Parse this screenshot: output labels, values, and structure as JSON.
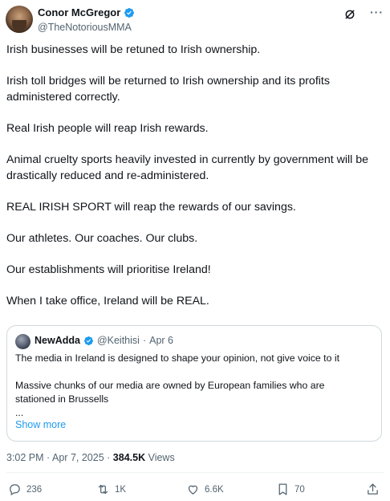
{
  "author": {
    "display_name": "Conor McGregor",
    "handle": "@TheNotoriousMMA"
  },
  "post": {
    "paragraphs": [
      "Irish businesses will be retuned to Irish ownership.",
      "Irish toll bridges will be returned to Irish ownership and its profits administered correctly.",
      "Real Irish people will reap Irish rewards.",
      "Animal cruelty sports heavily invested in currently by government will be drastically reduced and re-administered.",
      "REAL IRISH SPORT will reap the rewards of our savings.",
      "Our athletes. Our coaches. Our clubs.",
      "Our establishments will prioritise Ireland!",
      "When I take office, Ireland will be REAL."
    ]
  },
  "quote": {
    "display_name": "NewAdda",
    "handle": "@Keithisi",
    "separator": "·",
    "date": "Apr 6",
    "line1": "The media in Ireland is designed to shape your opinion, not give voice to it",
    "line2": "Massive chunks of our media are owned by European families who are",
    "line3": "stationed in Brussells",
    "line4": "...",
    "show_more": "Show more"
  },
  "meta": {
    "time": "3:02 PM",
    "separator": "·",
    "date": "Apr 7, 2025",
    "separator2": "·",
    "views_count": "384.5K",
    "views_label": "Views"
  },
  "actions": {
    "replies": "236",
    "reposts": "1K",
    "likes": "6.6K",
    "bookmarks": "70"
  },
  "colors": {
    "verified": "#1d9bf0",
    "link": "#1d9bf0",
    "secondary_text": "#536471"
  }
}
